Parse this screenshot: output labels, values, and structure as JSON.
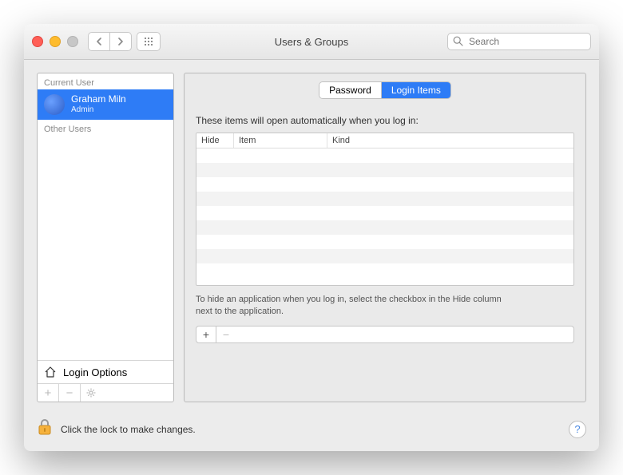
{
  "window": {
    "title": "Users & Groups"
  },
  "toolbar": {
    "search_placeholder": "Search"
  },
  "sidebar": {
    "current_label": "Current User",
    "other_label": "Other Users",
    "user": {
      "name": "Graham Miln",
      "role": "Admin"
    },
    "login_options": "Login Options",
    "footer": {
      "plus": "+",
      "minus": "−",
      "gear": "✻"
    }
  },
  "tabs": {
    "password": "Password",
    "login_items": "Login Items"
  },
  "main": {
    "instruction": "These items will open automatically when you log in:",
    "columns": {
      "hide": "Hide",
      "item": "Item",
      "kind": "Kind"
    },
    "hint": "To hide an application when you log in, select the checkbox in the Hide column next to the application.",
    "add": "+",
    "remove": "−"
  },
  "footer": {
    "lock_text": "Click the lock to make changes.",
    "help": "?"
  }
}
